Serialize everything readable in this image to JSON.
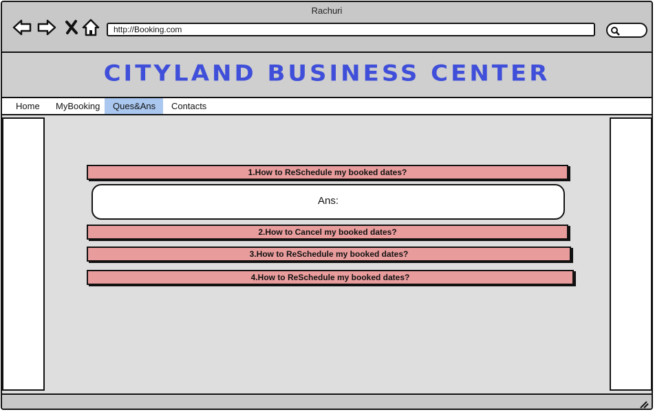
{
  "window": {
    "title": "Rachuri"
  },
  "browser": {
    "url": "http://Booking.com",
    "icons": [
      "back-arrow-icon",
      "forward-arrow-icon",
      "close-x-icon",
      "home-icon",
      "search-icon"
    ]
  },
  "banner": {
    "title": "CITYLAND BUSINESS CENTER",
    "color": "#3f4fd9"
  },
  "menu": {
    "items": [
      {
        "label": "Home",
        "active": false
      },
      {
        "label": "MyBooking",
        "active": false
      },
      {
        "label": "Ques&Ans",
        "active": true
      },
      {
        "label": "Contacts",
        "active": false
      }
    ],
    "active_color": "#a9c7ef"
  },
  "faq": {
    "questions": [
      "1.How to  ReSchedule my booked dates?",
      "2.How to  Cancel my booked dates?",
      "3.How to  ReSchedule my booked dates?",
      "4.How to  ReSchedule my booked dates?"
    ],
    "answer_label": "Ans:",
    "question_color": "#e99c9c"
  }
}
